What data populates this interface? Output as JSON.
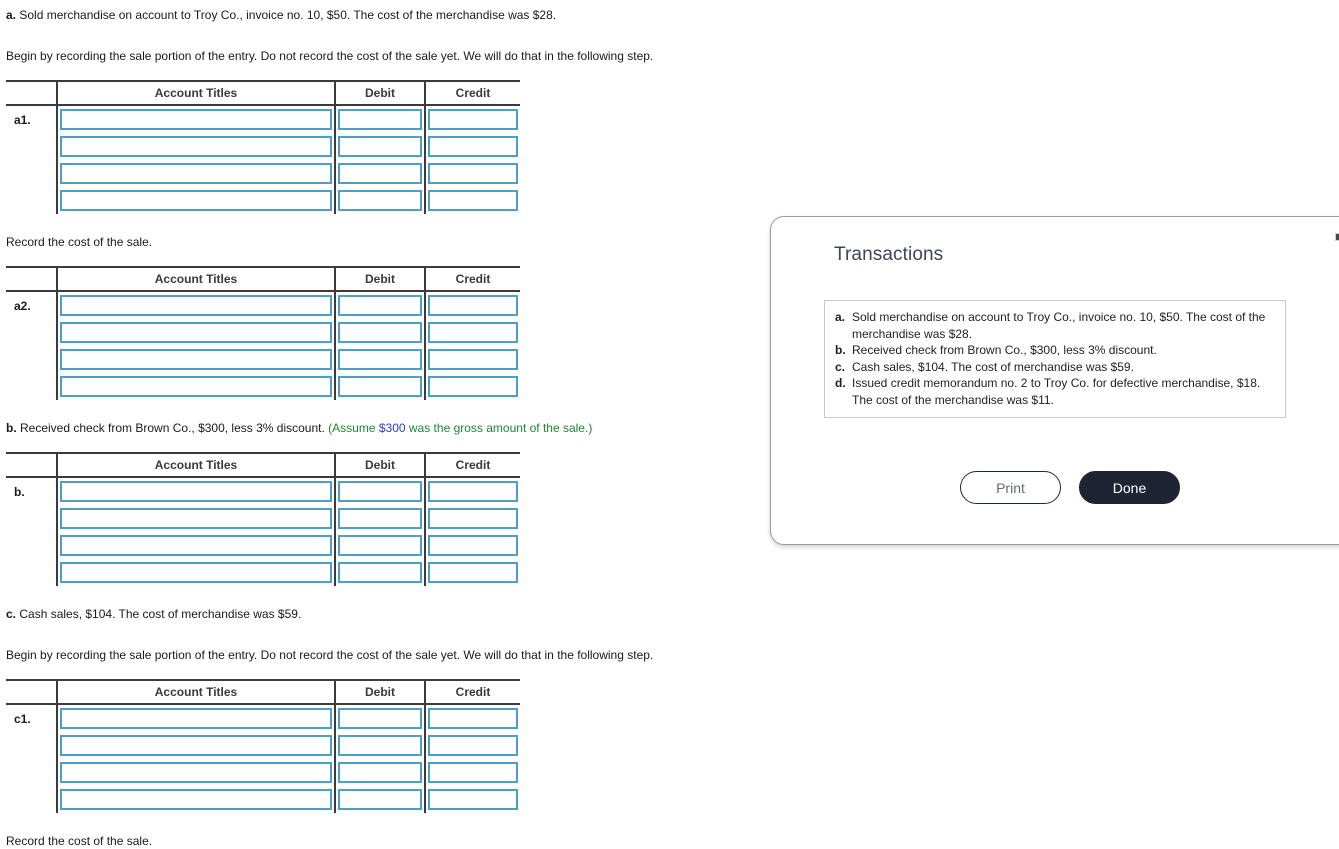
{
  "worksheet": {
    "sections": [
      {
        "id": "a",
        "prompt_lead": "a.",
        "prompt_text": " Sold merchandise on account to Troy Co., invoice no. 10, $50. The cost of the merchandise was $28.",
        "instruction": "Begin by recording the sale portion of the entry. Do not record the cost of the sale yet. We will do that in the following step.",
        "row_label": "a1.",
        "columns": [
          "Account Titles",
          "Debit",
          "Credit"
        ],
        "rows": [
          {
            "account": "",
            "debit": "",
            "credit": ""
          },
          {
            "account": "",
            "debit": "",
            "credit": ""
          },
          {
            "account": "",
            "debit": "",
            "credit": ""
          },
          {
            "account": "",
            "debit": "",
            "credit": ""
          }
        ]
      },
      {
        "id": "a2",
        "instruction": "Record the cost of the sale.",
        "row_label": "a2.",
        "columns": [
          "Account Titles",
          "Debit",
          "Credit"
        ],
        "rows": [
          {
            "account": "",
            "debit": "",
            "credit": ""
          },
          {
            "account": "",
            "debit": "",
            "credit": ""
          },
          {
            "account": "",
            "debit": "",
            "credit": ""
          },
          {
            "account": "",
            "debit": "",
            "credit": ""
          }
        ]
      },
      {
        "id": "b",
        "prompt_lead": "b.",
        "prompt_text": " Received check from Brown Co., $300, less 3% discount. ",
        "assume_prefix": "(Assume ",
        "assume_amount": "$300",
        "assume_suffix": " was the gross amount of the sale.)",
        "row_label": "b.",
        "columns": [
          "Account Titles",
          "Debit",
          "Credit"
        ],
        "rows": [
          {
            "account": "",
            "debit": "",
            "credit": ""
          },
          {
            "account": "",
            "debit": "",
            "credit": ""
          },
          {
            "account": "",
            "debit": "",
            "credit": ""
          },
          {
            "account": "",
            "debit": "",
            "credit": ""
          }
        ]
      },
      {
        "id": "c",
        "prompt_lead": "c.",
        "prompt_text": " Cash sales, $104. The cost of merchandise was $59.",
        "instruction": "Begin by recording the sale portion of the entry. Do not record the cost of the sale yet. We will do that in the following step.",
        "row_label": "c1.",
        "columns": [
          "Account Titles",
          "Debit",
          "Credit"
        ],
        "rows": [
          {
            "account": "",
            "debit": "",
            "credit": ""
          },
          {
            "account": "",
            "debit": "",
            "credit": ""
          },
          {
            "account": "",
            "debit": "",
            "credit": ""
          },
          {
            "account": "",
            "debit": "",
            "credit": ""
          }
        ]
      }
    ],
    "footer_instruction": "Record the cost of the sale."
  },
  "panel": {
    "title": "Transactions",
    "minimize_icon": "minimize-icon",
    "transactions": [
      {
        "mark": "a.",
        "text": "Sold merchandise on account to Troy Co., invoice no. 10, $50. The cost of the merchandise was $28."
      },
      {
        "mark": "b.",
        "text": "Received check from Brown Co., $300, less 3% discount."
      },
      {
        "mark": "c.",
        "text": "Cash sales, $104. The cost of merchandise was $59."
      },
      {
        "mark": "d.",
        "text": "Issued credit memorandum no. 2 to Troy Co. for defective merchandise, $18. The cost of the merchandise was $11."
      }
    ],
    "buttons": {
      "print_label": "Print",
      "done_label": "Done"
    }
  },
  "colors": {
    "input_border": "#4f9fc4",
    "rule": "#3b3b3b",
    "assume_green": "#1a8a31",
    "assume_amount_blue": "#2b3fd0",
    "done_bg": "#1e2433",
    "panel_title": "#3d4659"
  }
}
